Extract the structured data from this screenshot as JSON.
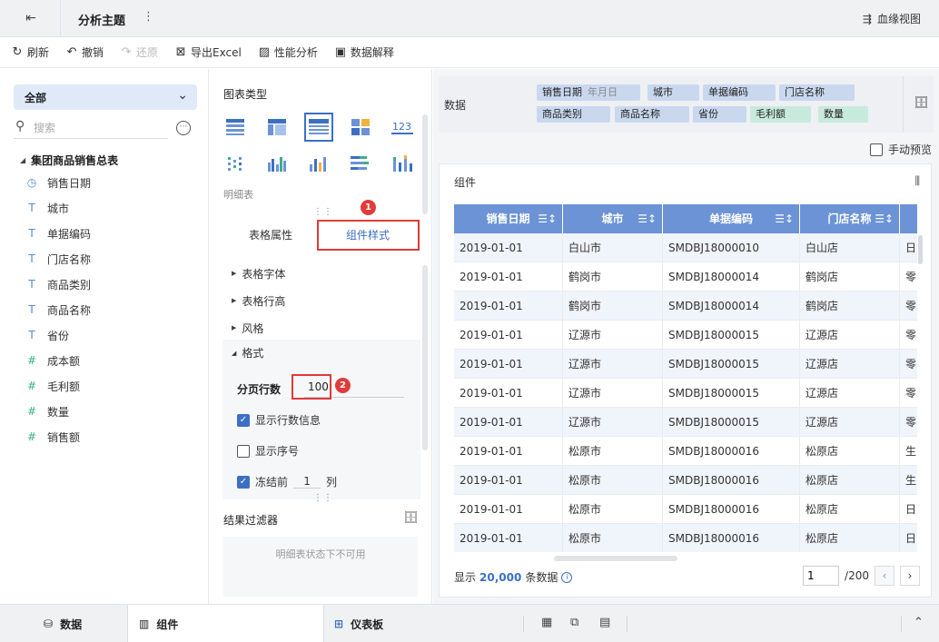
{
  "topbar": {
    "title": "分析主题",
    "more": "⋮",
    "lineage": "血缘视图"
  },
  "toolbar": [
    {
      "icon": "↻",
      "name": "refresh",
      "label": "刷新",
      "enabled": true
    },
    {
      "icon": "↶",
      "name": "undo",
      "label": "撤销",
      "enabled": true
    },
    {
      "icon": "↷",
      "name": "redo",
      "label": "还原",
      "enabled": false
    },
    {
      "icon": "⊠",
      "name": "export-excel",
      "label": "导出Excel",
      "enabled": true
    },
    {
      "icon": "▨",
      "name": "performance",
      "label": "性能分析",
      "enabled": true
    },
    {
      "icon": "▣",
      "name": "data-explain",
      "label": "数据解释",
      "enabled": true
    }
  ],
  "left": {
    "scope": "全部",
    "search_placeholder": "搜索",
    "root": "集团商品销售总表",
    "fields": [
      {
        "icon": "◷",
        "kind": "date",
        "label": "销售日期"
      },
      {
        "icon": "T",
        "kind": "text",
        "label": "城市"
      },
      {
        "icon": "T",
        "kind": "text",
        "label": "单据编码"
      },
      {
        "icon": "T",
        "kind": "text",
        "label": "门店名称"
      },
      {
        "icon": "T",
        "kind": "text",
        "label": "商品类别"
      },
      {
        "icon": "T",
        "kind": "text",
        "label": "商品名称"
      },
      {
        "icon": "T",
        "kind": "text",
        "label": "省份"
      },
      {
        "icon": "#",
        "kind": "num",
        "label": "成本额"
      },
      {
        "icon": "#",
        "kind": "num",
        "label": "毛利额"
      },
      {
        "icon": "#",
        "kind": "num",
        "label": "数量"
      },
      {
        "icon": "#",
        "kind": "num",
        "label": "销售额"
      }
    ]
  },
  "mid": {
    "chart_type_title": "图表类型",
    "chart_name": "明细表",
    "tabs": [
      "表格属性",
      "组件样式"
    ],
    "badges": [
      "1",
      "2"
    ],
    "sections": [
      "表格字体",
      "表格行高",
      "风格"
    ],
    "format_title": "格式",
    "page_rows_label": "分页行数",
    "page_rows_value": "100",
    "show_row_info": "显示行数信息",
    "show_index": "显示序号",
    "freeze_before": "冻结前",
    "freeze_value": "1",
    "freeze_unit": "列",
    "filter_title": "结果过滤器",
    "filter_empty": "明细表状态下不可用"
  },
  "right": {
    "data_label": "数据",
    "pills": [
      {
        "label": "销售日期",
        "sub": "年月日",
        "kind": "dim"
      },
      {
        "label": "城市",
        "kind": "dim"
      },
      {
        "label": "单据编码",
        "kind": "dim"
      },
      {
        "label": "门店名称",
        "kind": "dim"
      },
      {
        "label": "商品类别",
        "kind": "dim"
      },
      {
        "label": "商品名称",
        "kind": "dim"
      },
      {
        "label": "省份",
        "kind": "dim"
      },
      {
        "label": "毛利额",
        "kind": "mea"
      },
      {
        "label": "数量",
        "kind": "mea"
      }
    ],
    "manual_preview": "手动预览",
    "component_title": "组件",
    "table": {
      "columns": [
        "销售日期",
        "城市",
        "单据编码",
        "门店名称",
        ""
      ],
      "rows": [
        [
          "2019-01-01",
          "白山市",
          "SMDBJ18000010",
          "白山店",
          "日"
        ],
        [
          "2019-01-01",
          "鹤岗市",
          "SMDBJ18000014",
          "鹤岗店",
          "零"
        ],
        [
          "2019-01-01",
          "鹤岗市",
          "SMDBJ18000014",
          "鹤岗店",
          "零"
        ],
        [
          "2019-01-01",
          "辽源市",
          "SMDBJ18000015",
          "辽源店",
          "零"
        ],
        [
          "2019-01-01",
          "辽源市",
          "SMDBJ18000015",
          "辽源店",
          "零"
        ],
        [
          "2019-01-01",
          "辽源市",
          "SMDBJ18000015",
          "辽源店",
          "零"
        ],
        [
          "2019-01-01",
          "辽源市",
          "SMDBJ18000015",
          "辽源店",
          "零"
        ],
        [
          "2019-01-01",
          "松原市",
          "SMDBJ18000016",
          "松原店",
          "生"
        ],
        [
          "2019-01-01",
          "松原市",
          "SMDBJ18000016",
          "松原店",
          "生"
        ],
        [
          "2019-01-01",
          "松原市",
          "SMDBJ18000016",
          "松原店",
          "日"
        ],
        [
          "2019-01-01",
          "松原市",
          "SMDBJ18000016",
          "松原店",
          "日"
        ],
        [
          "",
          "",
          "",
          "",
          ""
        ]
      ]
    },
    "footer": {
      "prefix": "显示",
      "count": "20,000",
      "suffix": "条数据"
    },
    "pager": {
      "current": "1",
      "total": "/200"
    }
  },
  "bottom": {
    "tabs": [
      "数据",
      "组件",
      "仪表板"
    ]
  },
  "colors": {
    "accent": "#3c6fc2",
    "header": "#6b93d6",
    "alert": "#e03a3a"
  }
}
